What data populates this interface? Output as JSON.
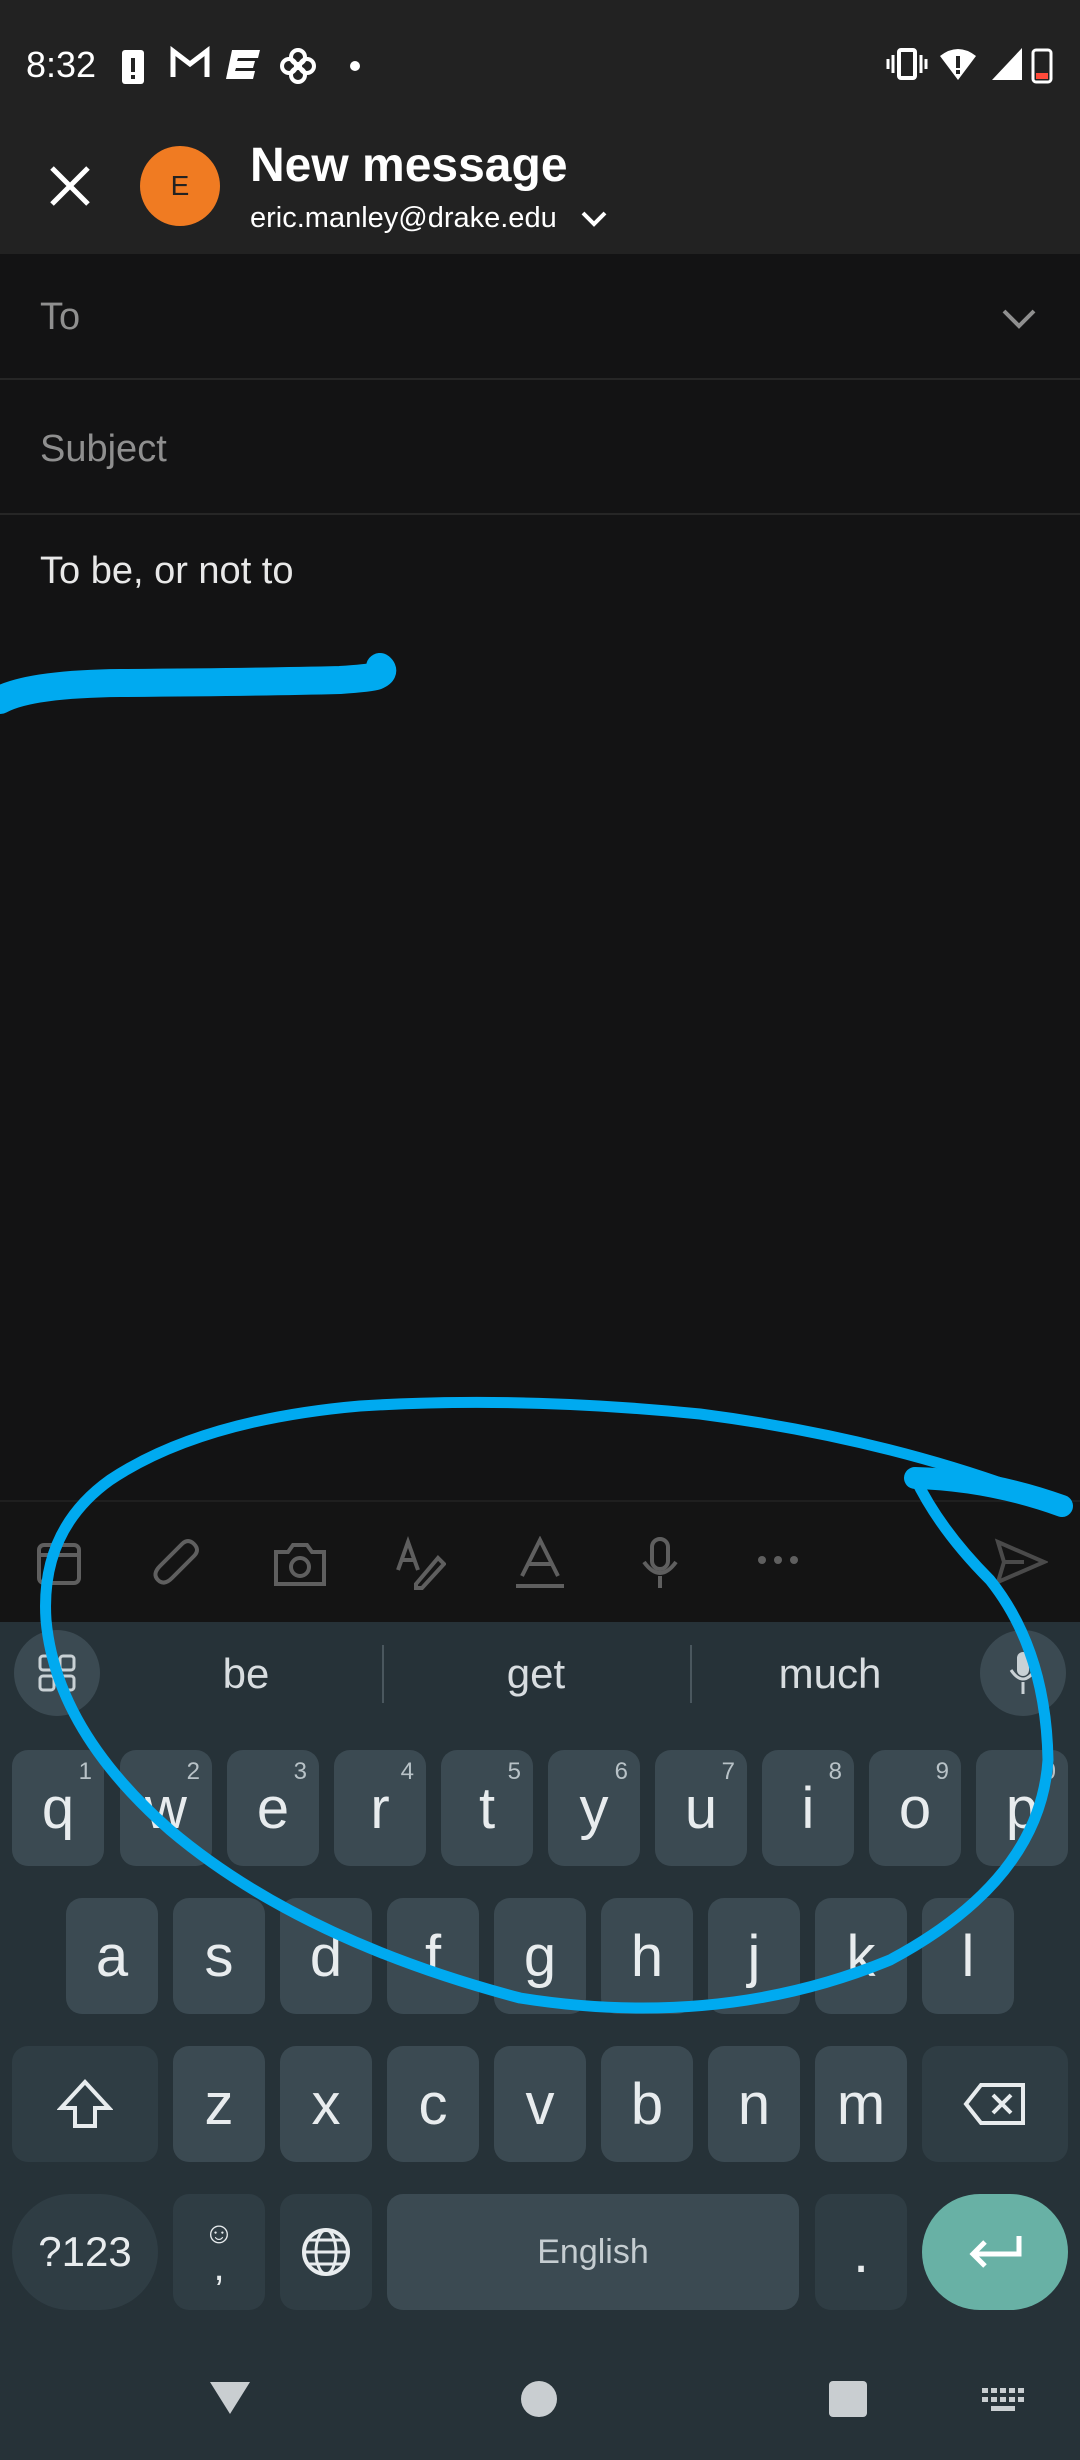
{
  "status_bar": {
    "time": "8:32"
  },
  "header": {
    "title": "New message",
    "account": "eric.manley@drake.edu",
    "avatar_initial": "E"
  },
  "fields": {
    "to_label": "To",
    "subject_label": "Subject",
    "body": "To be, or not to"
  },
  "keyboard": {
    "suggestions": [
      "be",
      "get",
      "much"
    ],
    "row1": [
      {
        "key": "q",
        "hint": "1"
      },
      {
        "key": "w",
        "hint": "2"
      },
      {
        "key": "e",
        "hint": "3"
      },
      {
        "key": "r",
        "hint": "4"
      },
      {
        "key": "t",
        "hint": "5"
      },
      {
        "key": "y",
        "hint": "6"
      },
      {
        "key": "u",
        "hint": "7"
      },
      {
        "key": "i",
        "hint": "8"
      },
      {
        "key": "o",
        "hint": "9"
      },
      {
        "key": "p",
        "hint": "0"
      }
    ],
    "row2": [
      "a",
      "s",
      "d",
      "f",
      "g",
      "h",
      "j",
      "k",
      "l"
    ],
    "row3": [
      "z",
      "x",
      "c",
      "v",
      "b",
      "n",
      "m"
    ],
    "symbols_label": "?123",
    "comma_label": ",",
    "space_label": "English",
    "period_label": "."
  },
  "colors": {
    "accent_annotation": "#00aaf0",
    "avatar": "#f07b22",
    "enter_key": "#68b1a5"
  }
}
